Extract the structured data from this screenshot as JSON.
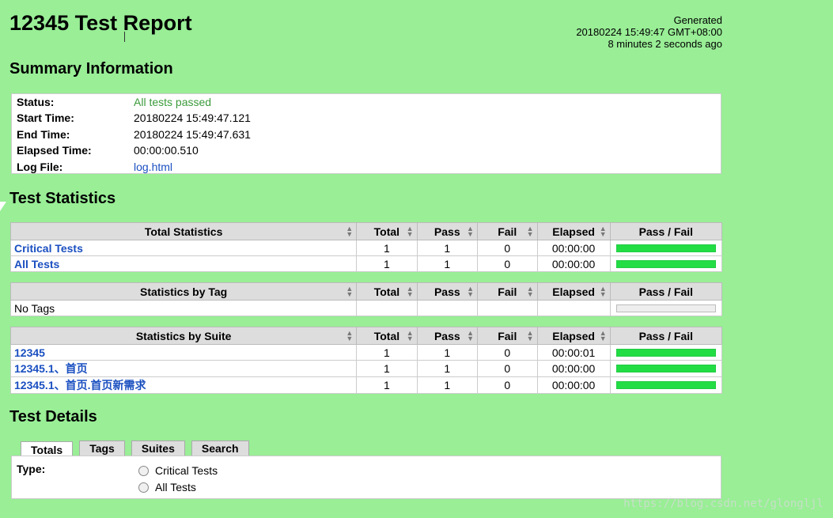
{
  "report": {
    "title": "12345 Test Report",
    "generated_label": "Generated",
    "generated_time": "20180224 15:49:47 GMT+08:00",
    "generated_ago": "8 minutes 2 seconds ago"
  },
  "summary": {
    "heading": "Summary Information",
    "rows": [
      {
        "label": "Status:",
        "value": "All tests passed"
      },
      {
        "label": "Start Time:",
        "value": "20180224 15:49:47.121"
      },
      {
        "label": "End Time:",
        "value": "20180224 15:49:47.631"
      },
      {
        "label": "Elapsed Time:",
        "value": "00:00:00.510"
      },
      {
        "label": "Log File:",
        "value": "log.html"
      }
    ]
  },
  "statistics": {
    "heading": "Test Statistics",
    "columns": [
      "Total",
      "Pass",
      "Fail",
      "Elapsed",
      "Pass / Fail"
    ],
    "total": {
      "header": "Total Statistics",
      "rows": [
        {
          "name": "Critical Tests",
          "total": "1",
          "pass": "1",
          "fail": "0",
          "elapsed": "00:00:00",
          "pass_ratio": 1
        },
        {
          "name": "All Tests",
          "total": "1",
          "pass": "1",
          "fail": "0",
          "elapsed": "00:00:00",
          "pass_ratio": 1
        }
      ]
    },
    "tag": {
      "header": "Statistics by Tag",
      "rows": [
        {
          "name": "No Tags",
          "total": "",
          "pass": "",
          "fail": "",
          "elapsed": "",
          "pass_ratio": 0
        }
      ]
    },
    "suite": {
      "header": "Statistics by Suite",
      "rows": [
        {
          "name": "12345",
          "total": "1",
          "pass": "1",
          "fail": "0",
          "elapsed": "00:00:01",
          "pass_ratio": 1
        },
        {
          "name": "12345.1、首页",
          "total": "1",
          "pass": "1",
          "fail": "0",
          "elapsed": "00:00:00",
          "pass_ratio": 1
        },
        {
          "name": "12345.1、首页.首页新需求",
          "total": "1",
          "pass": "1",
          "fail": "0",
          "elapsed": "00:00:00",
          "pass_ratio": 1
        }
      ]
    }
  },
  "details": {
    "heading": "Test Details",
    "tabs": [
      "Totals",
      "Tags",
      "Suites",
      "Search"
    ],
    "type_label": "Type:",
    "options": [
      "Critical Tests",
      "All Tests"
    ]
  },
  "watermark": "https://blog.csdn.net/glongljl",
  "colors": {
    "background": "#99ee96",
    "pass_bar": "#22dd44",
    "link": "#1a4fc0"
  }
}
